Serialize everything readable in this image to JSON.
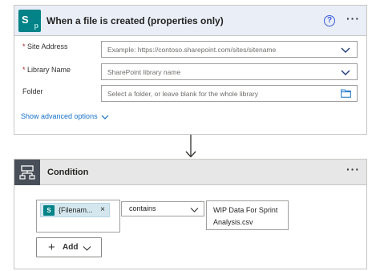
{
  "trigger": {
    "title": "When a file is created (properties only)",
    "help_icon": "?",
    "more_icon": "···",
    "fields": [
      {
        "label": "Site Address",
        "required": "*",
        "placeholder": "Example: https://contoso.sharepoint.com/sites/sitename",
        "control": "dropdown"
      },
      {
        "label": "Library Name",
        "required": "*",
        "placeholder": "SharePoint library name",
        "control": "dropdown"
      },
      {
        "label": "Folder",
        "required": "",
        "placeholder": "Select a folder, or leave blank for the whole library",
        "control": "folder-picker"
      }
    ],
    "advanced_link": "Show advanced options"
  },
  "condition": {
    "title": "Condition",
    "more_icon": "···",
    "left_token": {
      "text": "{Filenam...",
      "remove": "×"
    },
    "operator": "contains",
    "right_value": "WIP Data For Sprint Analysis.csv",
    "add_button": "Add",
    "add_plus": "+"
  },
  "icons": {
    "sharepoint": "sharepoint-icon",
    "condition": "condition-icon",
    "dropdown": "chevron-down-icon",
    "folder": "folder-icon",
    "arrow": "arrow-down-icon"
  },
  "colors": {
    "sharepoint_teal": "#038387",
    "link_blue": "#1570c8",
    "trigger_header_bg": "#e9eef7",
    "condition_header_bg": "#e7e7e7",
    "token_bg": "#d4e7ee",
    "required_red": "#a4262c"
  }
}
